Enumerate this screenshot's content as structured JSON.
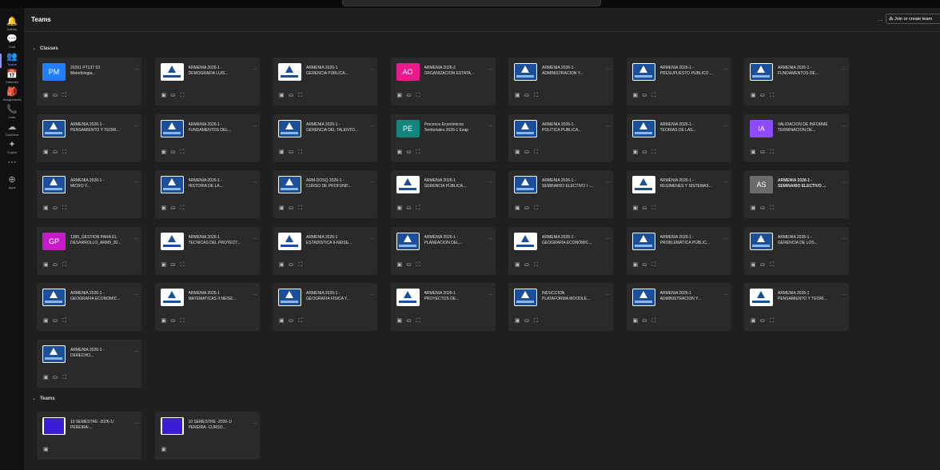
{
  "rail": [
    {
      "name": "activity",
      "icon": "🔔",
      "label": "Activity"
    },
    {
      "name": "chat",
      "icon": "💬",
      "label": "Chat"
    },
    {
      "name": "teams",
      "icon": "👥",
      "label": "Teams"
    },
    {
      "name": "calendar",
      "icon": "📅",
      "label": "Calendar"
    },
    {
      "name": "assignments",
      "icon": "🎒",
      "label": "Assignments"
    },
    {
      "name": "calls",
      "icon": "📞",
      "label": "Calls"
    },
    {
      "name": "onedrive",
      "icon": "☁",
      "label": "OneDrive"
    },
    {
      "name": "copilot",
      "icon": "✦",
      "label": "Copilot"
    },
    {
      "name": "more",
      "icon": "⋯",
      "label": ""
    },
    {
      "name": "apps",
      "icon": "⊕",
      "label": "Apps"
    }
  ],
  "header": {
    "title": "Teams",
    "more": "...",
    "join": "Join or create team",
    "join_icon": "⁂"
  },
  "sections": {
    "classes": "Classes",
    "teams": "Teams",
    "chevron": "⌄"
  },
  "card_more": "···",
  "card_icons": [
    "▣",
    "⛀",
    "⛶"
  ],
  "classes": [
    {
      "avatar": "initials",
      "initials": "PM",
      "color": "#1f7fff",
      "name": "20261 PT137 53\nMetodologia..."
    },
    {
      "avatar": "logo-white",
      "name": "ARMENIA 2026-1 -\nDEMOGRAFIA LUIS..."
    },
    {
      "avatar": "logo-white",
      "name": "ARMENIA 2026-1\nGERENCIA PÚBLICA..."
    },
    {
      "avatar": "initials",
      "initials": "AO",
      "color": "#e61b8c",
      "name": "ARMENIA 2026-2\nORGANIZACION ESTATA..."
    },
    {
      "avatar": "logo",
      "name": "ARMENIA 2026-1 -\nADMINISTRACION Y..."
    },
    {
      "avatar": "logo",
      "name": "ARMENIA 2026-1 -\nPRESUPUESTO PUBLICO ..."
    },
    {
      "avatar": "logo",
      "name": "ARMENIA 2026-1 -\nFUNDAMENTOS DE..."
    },
    {
      "avatar": "logo",
      "name": "ARMENIA 2026-1 -\nPENSAMIENTO Y TEORI..."
    },
    {
      "avatar": "logo",
      "name": "ARMENIA 2026-1 -\nFUNDAMENTOS DEL..."
    },
    {
      "avatar": "logo",
      "name": "ARMENIA 2026-1 -\nGERENCIA DEL TALENTO..."
    },
    {
      "avatar": "initials",
      "initials": "PE",
      "color": "#13857d",
      "name": "Procesos Económicos\nTerritoriales 2026-1 Esap"
    },
    {
      "avatar": "logo",
      "name": "ARMENIA 2026-1 -\nPOLITICA PUBLICA..."
    },
    {
      "avatar": "logo",
      "name": "ARMENIA 2026-1 -\nTEORIAS DE LAS..."
    },
    {
      "avatar": "initials",
      "initials": "IA",
      "color": "#8c4bff",
      "name": "VALIDACION DE INFORME\nTERMINACION DE..."
    },
    {
      "avatar": "logo",
      "name": "ARMENIA 2026-1 -\nMICRO Y..."
    },
    {
      "avatar": "logo",
      "name": "ARMENIA 2026-1 -\nHISTORIA DE LA..."
    },
    {
      "avatar": "logo",
      "name": "ARM-DOSQ 2026-1 -\nCURSO DE PROFUND..."
    },
    {
      "avatar": "logo-white",
      "name": "ARMENIA 2026-1\nGERENCIA PÚBLICA..."
    },
    {
      "avatar": "logo",
      "name": "ARMENIA 2026-1 -\nSEMINARIO ELECTIVO I -..."
    },
    {
      "avatar": "logo-white",
      "name": "ARMENIA 2026-1 -\nREGIMENES Y SISTEMAS..."
    },
    {
      "avatar": "initials",
      "initials": "AS",
      "color": "#6b6b6b",
      "name": "ARMENIA 2026-1 -\nSEMINARIO ELECTIVO ...",
      "bold": true
    },
    {
      "avatar": "initials",
      "initials": "GP",
      "color": "#c81bc8",
      "name": "1385_GESTION PARA EL\nDESARROLLO_ARM9_20..."
    },
    {
      "avatar": "logo-white",
      "name": "ARMENIA 2026-1\nTECNICAS DEL PROYECT..."
    },
    {
      "avatar": "logo-white",
      "name": "ARMENIA 2026-1\nESTADISTICA II-NEISE..."
    },
    {
      "avatar": "logo",
      "name": "ARMENIA 2026-1 -\nPLANEACION DEL..."
    },
    {
      "avatar": "logo-white",
      "name": "ARMENIA 2026-1 -\nGEOGRAFÍA ECONÓMIC..."
    },
    {
      "avatar": "logo",
      "name": "ARMENIA 2026-1 -\nPROBLEMÁTICA PÚBLIC..."
    },
    {
      "avatar": "logo",
      "name": "ARMENIA 2026-1 -\nGERENCIA DE LOS..."
    },
    {
      "avatar": "logo",
      "name": "ARMENIA 2026-1 -\nGEOGRAFIA ECONOMIC..."
    },
    {
      "avatar": "logo-white",
      "name": "ARMENIA 2026-1\nMATEMATICAS II NEISE..."
    },
    {
      "avatar": "logo",
      "name": "ARMENIA 2026-1 -\nGEOGRAFIA FISICA Y..."
    },
    {
      "avatar": "logo-white",
      "name": "ARMENIA 2026-1\nPROYECTOS DE..."
    },
    {
      "avatar": "logo",
      "name": "INDUCCION\nPLATAFORMA MOODLE..."
    },
    {
      "avatar": "logo",
      "name": "ARMENIA 2026-1\nADMINISTRACION Y..."
    },
    {
      "avatar": "logo-white",
      "name": "ARMENIA 2026-1\nPENSAMIENTO Y TEORI..."
    },
    {
      "avatar": "logo",
      "name": "ARMENIA 2026-1 -\nDERECHO..."
    }
  ],
  "teams": [
    {
      "avatar": "blue-square",
      "name": "10 SEMESTRE -2026-1/\nPEREIRA-..."
    },
    {
      "avatar": "blue-square",
      "name": "10 SEMESTRE -2026-1/\nPEREIRA- CURSO..."
    }
  ]
}
